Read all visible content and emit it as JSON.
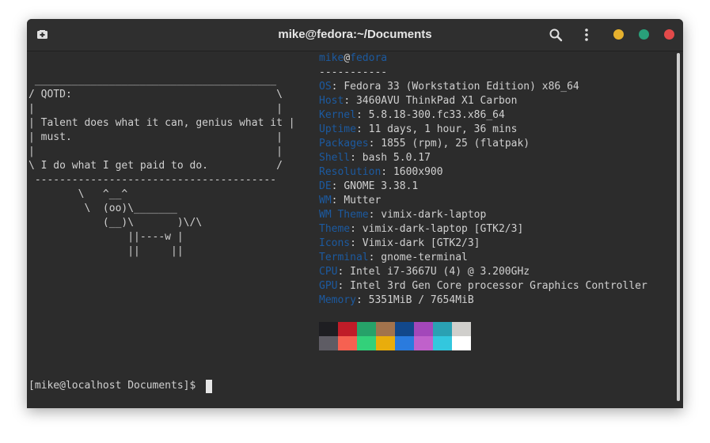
{
  "window": {
    "title": "mike@fedora:~/Documents",
    "buttons": {
      "minimize_color": "#e6b12e",
      "maximize_color": "#29a07a",
      "close_color": "#e34a4a"
    },
    "icons": {
      "new_tab": "new-tab-icon",
      "search": "search-icon",
      "menu": "kebab-menu-icon"
    }
  },
  "terminal": {
    "cowsay": [
      " _______________________________________",
      "/ QOTD:                                 \\",
      "|                                       |",
      "| Talent does what it can, genius what it |",
      "| must.                                 |",
      "|                                       |",
      "\\ I do what I get paid to do.           /",
      " ---------------------------------------",
      "        \\   ^__^",
      "         \\  (oo)\\_______",
      "            (__)\\       )\\/\\",
      "                ||----w |",
      "                ||     ||"
    ],
    "header": {
      "user": "mike",
      "at": "@",
      "host": "fedora",
      "separator": "-----------"
    },
    "info": [
      {
        "key": "OS",
        "value": "Fedora 33 (Workstation Edition) x86_64"
      },
      {
        "key": "Host",
        "value": "3460AVU ThinkPad X1 Carbon"
      },
      {
        "key": "Kernel",
        "value": "5.8.18-300.fc33.x86_64"
      },
      {
        "key": "Uptime",
        "value": "11 days, 1 hour, 36 mins"
      },
      {
        "key": "Packages",
        "value": "1855 (rpm), 25 (flatpak)"
      },
      {
        "key": "Shell",
        "value": "bash 5.0.17"
      },
      {
        "key": "Resolution",
        "value": "1600x900"
      },
      {
        "key": "DE",
        "value": "GNOME 3.38.1"
      },
      {
        "key": "WM",
        "value": "Mutter"
      },
      {
        "key": "WM Theme",
        "value": "vimix-dark-laptop"
      },
      {
        "key": "Theme",
        "value": "vimix-dark-laptop [GTK2/3]"
      },
      {
        "key": "Icons",
        "value": "Vimix-dark [GTK2/3]"
      },
      {
        "key": "Terminal",
        "value": "gnome-terminal"
      },
      {
        "key": "CPU",
        "value": "Intel i7-3667U (4) @ 3.200GHz"
      },
      {
        "key": "GPU",
        "value": "Intel 3rd Gen Core processor Graphics Controller"
      },
      {
        "key": "Memory",
        "value": "5351MiB / 7654MiB"
      }
    ],
    "palette_top": [
      "#1e1e22",
      "#c01c28",
      "#26a269",
      "#a2734c",
      "#12488b",
      "#a347ba",
      "#2aa1b3",
      "#d0cfcc"
    ],
    "palette_bottom": [
      "#5e5c64",
      "#f66151",
      "#33d17a",
      "#e9ad0c",
      "#2a7bde",
      "#c061cb",
      "#33c7de",
      "#ffffff"
    ],
    "prompt": "[mike@localhost Documents]$ "
  },
  "colors": {
    "key_color": "#1c5aa0",
    "text_color": "#d0d0d0",
    "background": "#2c2c2c"
  }
}
